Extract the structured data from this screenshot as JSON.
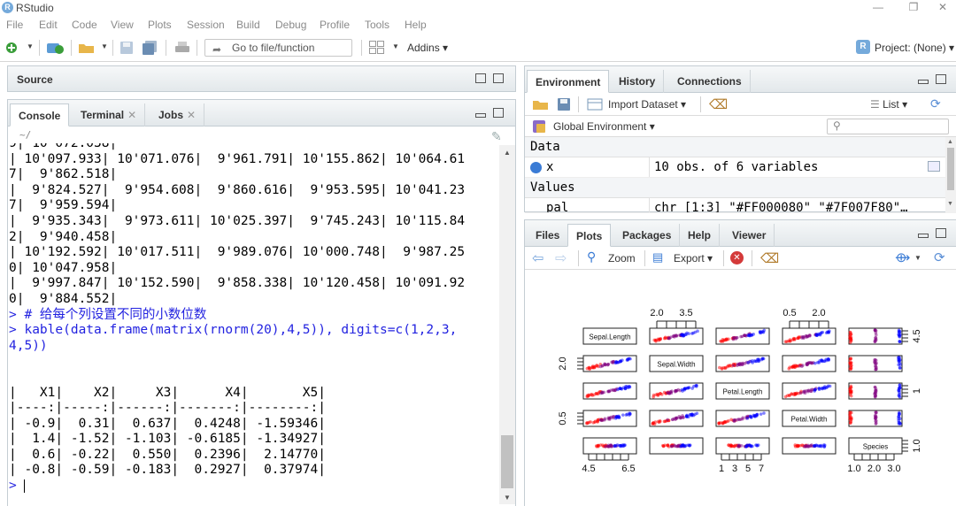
{
  "window": {
    "title": "RStudio",
    "logo_letter": "R",
    "minimize": "—",
    "restore": "❐",
    "close": "✕"
  },
  "menu": [
    "File",
    "Edit",
    "Code",
    "View",
    "Plots",
    "Session",
    "Build",
    "Debug",
    "Profile",
    "Tools",
    "Help"
  ],
  "toolbar": {
    "goto_placeholder": "Go to file/function",
    "addins": "Addins ▾",
    "project": "Project: (None) ▾"
  },
  "source_pane": {
    "title": "Source"
  },
  "console_pane": {
    "tabs": [
      "Console",
      "Terminal",
      "Jobs"
    ],
    "path": "~/",
    "lines": [
      {
        "text": "| 10'097.933| 10'071.076|  9'961.791| 10'155.862| 10'064.61",
        "type": "out"
      },
      {
        "text": "7|  9'862.518|",
        "type": "out"
      },
      {
        "text": "|  9'824.527|  9'954.608|  9'860.616|  9'953.595| 10'041.23",
        "type": "out"
      },
      {
        "text": "7|  9'959.594|",
        "type": "out"
      },
      {
        "text": "|  9'935.343|  9'973.611| 10'025.397|  9'745.243| 10'115.84",
        "type": "out"
      },
      {
        "text": "2|  9'940.458|",
        "type": "out"
      },
      {
        "text": "| 10'192.592| 10'017.511|  9'989.076| 10'000.748|  9'987.25",
        "type": "out"
      },
      {
        "text": "0| 10'047.958|",
        "type": "out"
      },
      {
        "text": "|  9'997.847| 10'152.590|  9'858.338| 10'120.458| 10'091.92",
        "type": "out"
      },
      {
        "text": "0|  9'884.552|",
        "type": "out"
      },
      {
        "text": "> # 给每个列设置不同的小数位数",
        "type": "cmd"
      },
      {
        "text": "> kable(data.frame(matrix(rnorm(20),4,5)), digits=c(1,2,3,",
        "type": "cmd"
      },
      {
        "text": "4,5))",
        "type": "cmd"
      },
      {
        "text": "",
        "type": "out"
      },
      {
        "text": "",
        "type": "out"
      },
      {
        "text": "|   X1|    X2|     X3|      X4|       X5|",
        "type": "out"
      },
      {
        "text": "|----:|-----:|------:|-------:|--------:|",
        "type": "out"
      },
      {
        "text": "| -0.9|  0.31|  0.637|  0.4248| -1.59346|",
        "type": "out"
      },
      {
        "text": "|  1.4| -1.52| -1.103| -0.6185| -1.34927|",
        "type": "out"
      },
      {
        "text": "|  0.6| -0.22|  0.550|  0.2396|  2.14770|",
        "type": "out"
      },
      {
        "text": "| -0.8| -0.59| -0.183|  0.2927|  0.37974|",
        "type": "out"
      }
    ],
    "prompt": "> "
  },
  "env_pane": {
    "tabs": [
      "Environment",
      "History",
      "Connections"
    ],
    "import_label": "Import Dataset ▾",
    "list_label": "List ▾",
    "scope_label": "Global Environment ▾",
    "sections": {
      "data": "Data",
      "values": "Values"
    },
    "data_rows": [
      {
        "name": "x",
        "value": "10 obs. of 6 variables"
      }
    ],
    "value_rows": [
      {
        "name": "pal",
        "value": "chr [1:3] \"#FF000080\" \"#7F007F80\"…"
      }
    ]
  },
  "files_pane": {
    "tabs": [
      "Files",
      "Plots",
      "Packages",
      "Help",
      "Viewer"
    ],
    "zoom_label": "Zoom",
    "export_label": "Export ▾"
  },
  "pairs_plot": {
    "variables": [
      "Sepal.Length",
      "Sepal.Width",
      "Petal.Length",
      "Petal.Width",
      "Species"
    ],
    "top_axis": [
      [
        "2.0",
        "3.5"
      ],
      [
        "0.5",
        "2.0"
      ]
    ],
    "bottom_axis": [
      [
        "4.5",
        "6.5"
      ],
      [
        "1",
        "3",
        "5",
        "7"
      ],
      [
        "1.0",
        "2.0",
        "3.0"
      ]
    ],
    "left_axis": [
      [
        "2.0"
      ],
      [
        "0.5"
      ]
    ],
    "right_axis": [
      [
        "4.5"
      ],
      [
        "1"
      ],
      [
        "1.0"
      ]
    ],
    "colors": {
      "setosa": "#FF000080",
      "versicolor": "#7F007F80",
      "virginica": "#0000FF80"
    }
  },
  "icons": {
    "console_clear": "broom-icon",
    "env_clear": "broom-icon",
    "refresh": "refresh-icon"
  }
}
